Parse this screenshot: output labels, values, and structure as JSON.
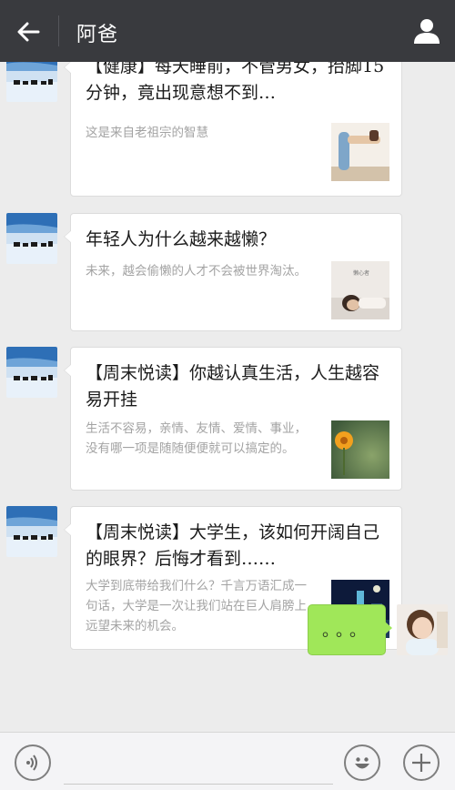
{
  "header": {
    "title": "阿爸",
    "back_icon": "arrow-left-icon",
    "profile_icon": "user-icon"
  },
  "messages": [
    {
      "title": "【健康】每天睡前，不管男女，抬脚15分钟，竟出现意想不到…",
      "description": "这是来自老祖宗的智慧"
    },
    {
      "title": "年轻人为什么越来越懒？",
      "description": "未来，越会偷懒的人才不会被世界淘汰。",
      "thumb_caption": "懒心者"
    },
    {
      "title": "【周末悦读】你越认真生活，人生越容易开挂",
      "description": "生活不容易，亲情、友情、爱情、事业，没有哪一项是随随便便就可以搞定的。"
    },
    {
      "title": "【周末悦读】大学生，该如何开阔自己的眼界？后悔才看到……",
      "description": "大学到底带给我们什么？千言万语汇成一句话，大学是一次让我们站在巨人肩膀上远望未来的机会。"
    }
  ],
  "my_message": {
    "text": "。。。"
  },
  "input_bar": {
    "voice_icon": "voice-icon",
    "emoji_icon": "emoji-icon",
    "plus_icon": "plus-icon"
  },
  "colors": {
    "header_bg": "#393a3e",
    "chat_bg": "#ececec",
    "my_bubble": "#a0e759"
  }
}
